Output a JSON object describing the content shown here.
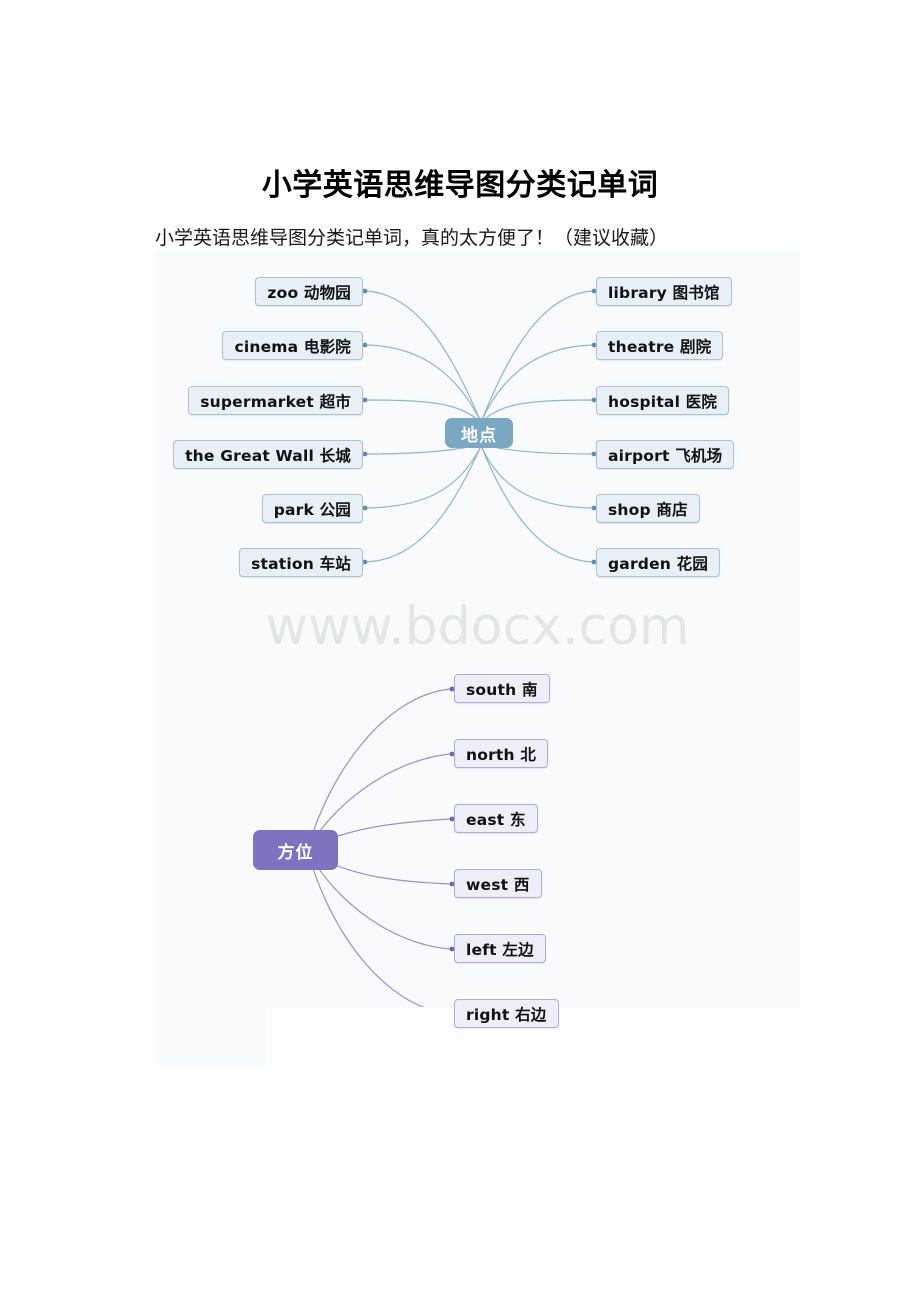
{
  "document": {
    "title": "小学英语思维导图分类记单词",
    "subtitle": "小学英语思维导图分类记单词，真的太方便了！（建议收藏）"
  },
  "figure": {
    "watermark": "www.bdocx.com",
    "colors": {
      "center_blue": "#7aa7c2",
      "center_purple": "#7e73c0",
      "node_blue_fill": "#e9f0f5",
      "node_blue_border": "#a9c3d3",
      "node_purple_fill": "#efedf8",
      "node_purple_border": "#b3aad8",
      "connector_blue": "#8fb4cc",
      "connector_purple": "#9a90cc",
      "watermark": "#e5e5e8",
      "canvas": "#f9fafc"
    },
    "maps": [
      {
        "id": "places-map",
        "center": "地点",
        "left_branches": [
          {
            "label": "zoo  动物园"
          },
          {
            "label": "cinema  电影院"
          },
          {
            "label": "supermarket  超市"
          },
          {
            "label": "the Great Wall  长城"
          },
          {
            "label": "park   公园"
          },
          {
            "label": "station  车站"
          }
        ],
        "right_branches": [
          {
            "label": "library   图书馆"
          },
          {
            "label": "theatre   剧院"
          },
          {
            "label": "hospital  医院"
          },
          {
            "label": "airport 飞机场"
          },
          {
            "label": "shop   商店"
          },
          {
            "label": "garden  花园"
          }
        ]
      },
      {
        "id": "directions-map",
        "center": "方位",
        "left_branches": [],
        "right_branches": [
          {
            "label": "south  南"
          },
          {
            "label": "north  北"
          },
          {
            "label": "east  东"
          },
          {
            "label": "west  西"
          },
          {
            "label": "left   左边"
          },
          {
            "label": "right  右边"
          }
        ]
      }
    ]
  }
}
